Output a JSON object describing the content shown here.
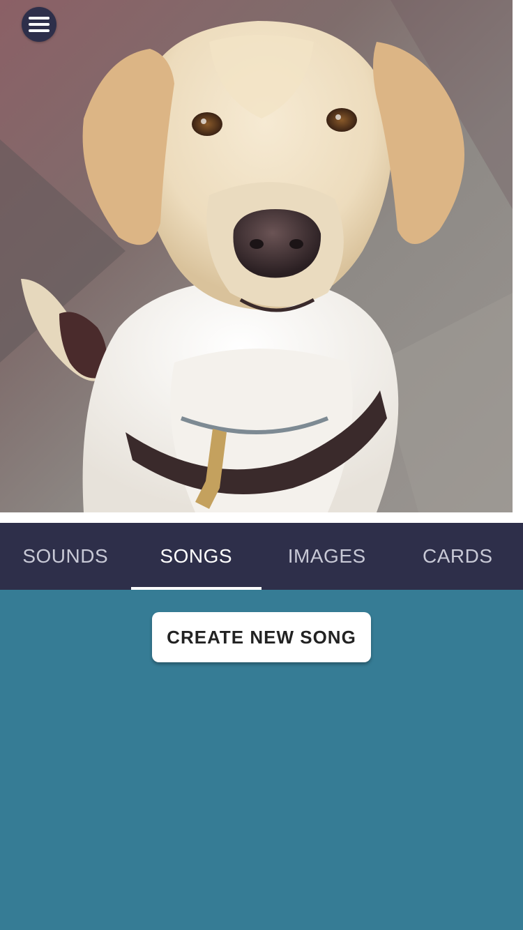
{
  "header": {
    "menu_icon": "hamburger-menu-icon"
  },
  "hero": {
    "subject": "dog-photo"
  },
  "tabs": [
    {
      "label": "SOUNDS",
      "active": false
    },
    {
      "label": "SONGS",
      "active": true
    },
    {
      "label": "IMAGES",
      "active": false
    },
    {
      "label": "CARDS",
      "active": false
    }
  ],
  "content": {
    "create_button_label": "CREATE NEW SONG"
  },
  "colors": {
    "tabbar_bg": "#2e2f4a",
    "content_bg": "#367c95",
    "menu_bg": "#2e2f4a"
  }
}
